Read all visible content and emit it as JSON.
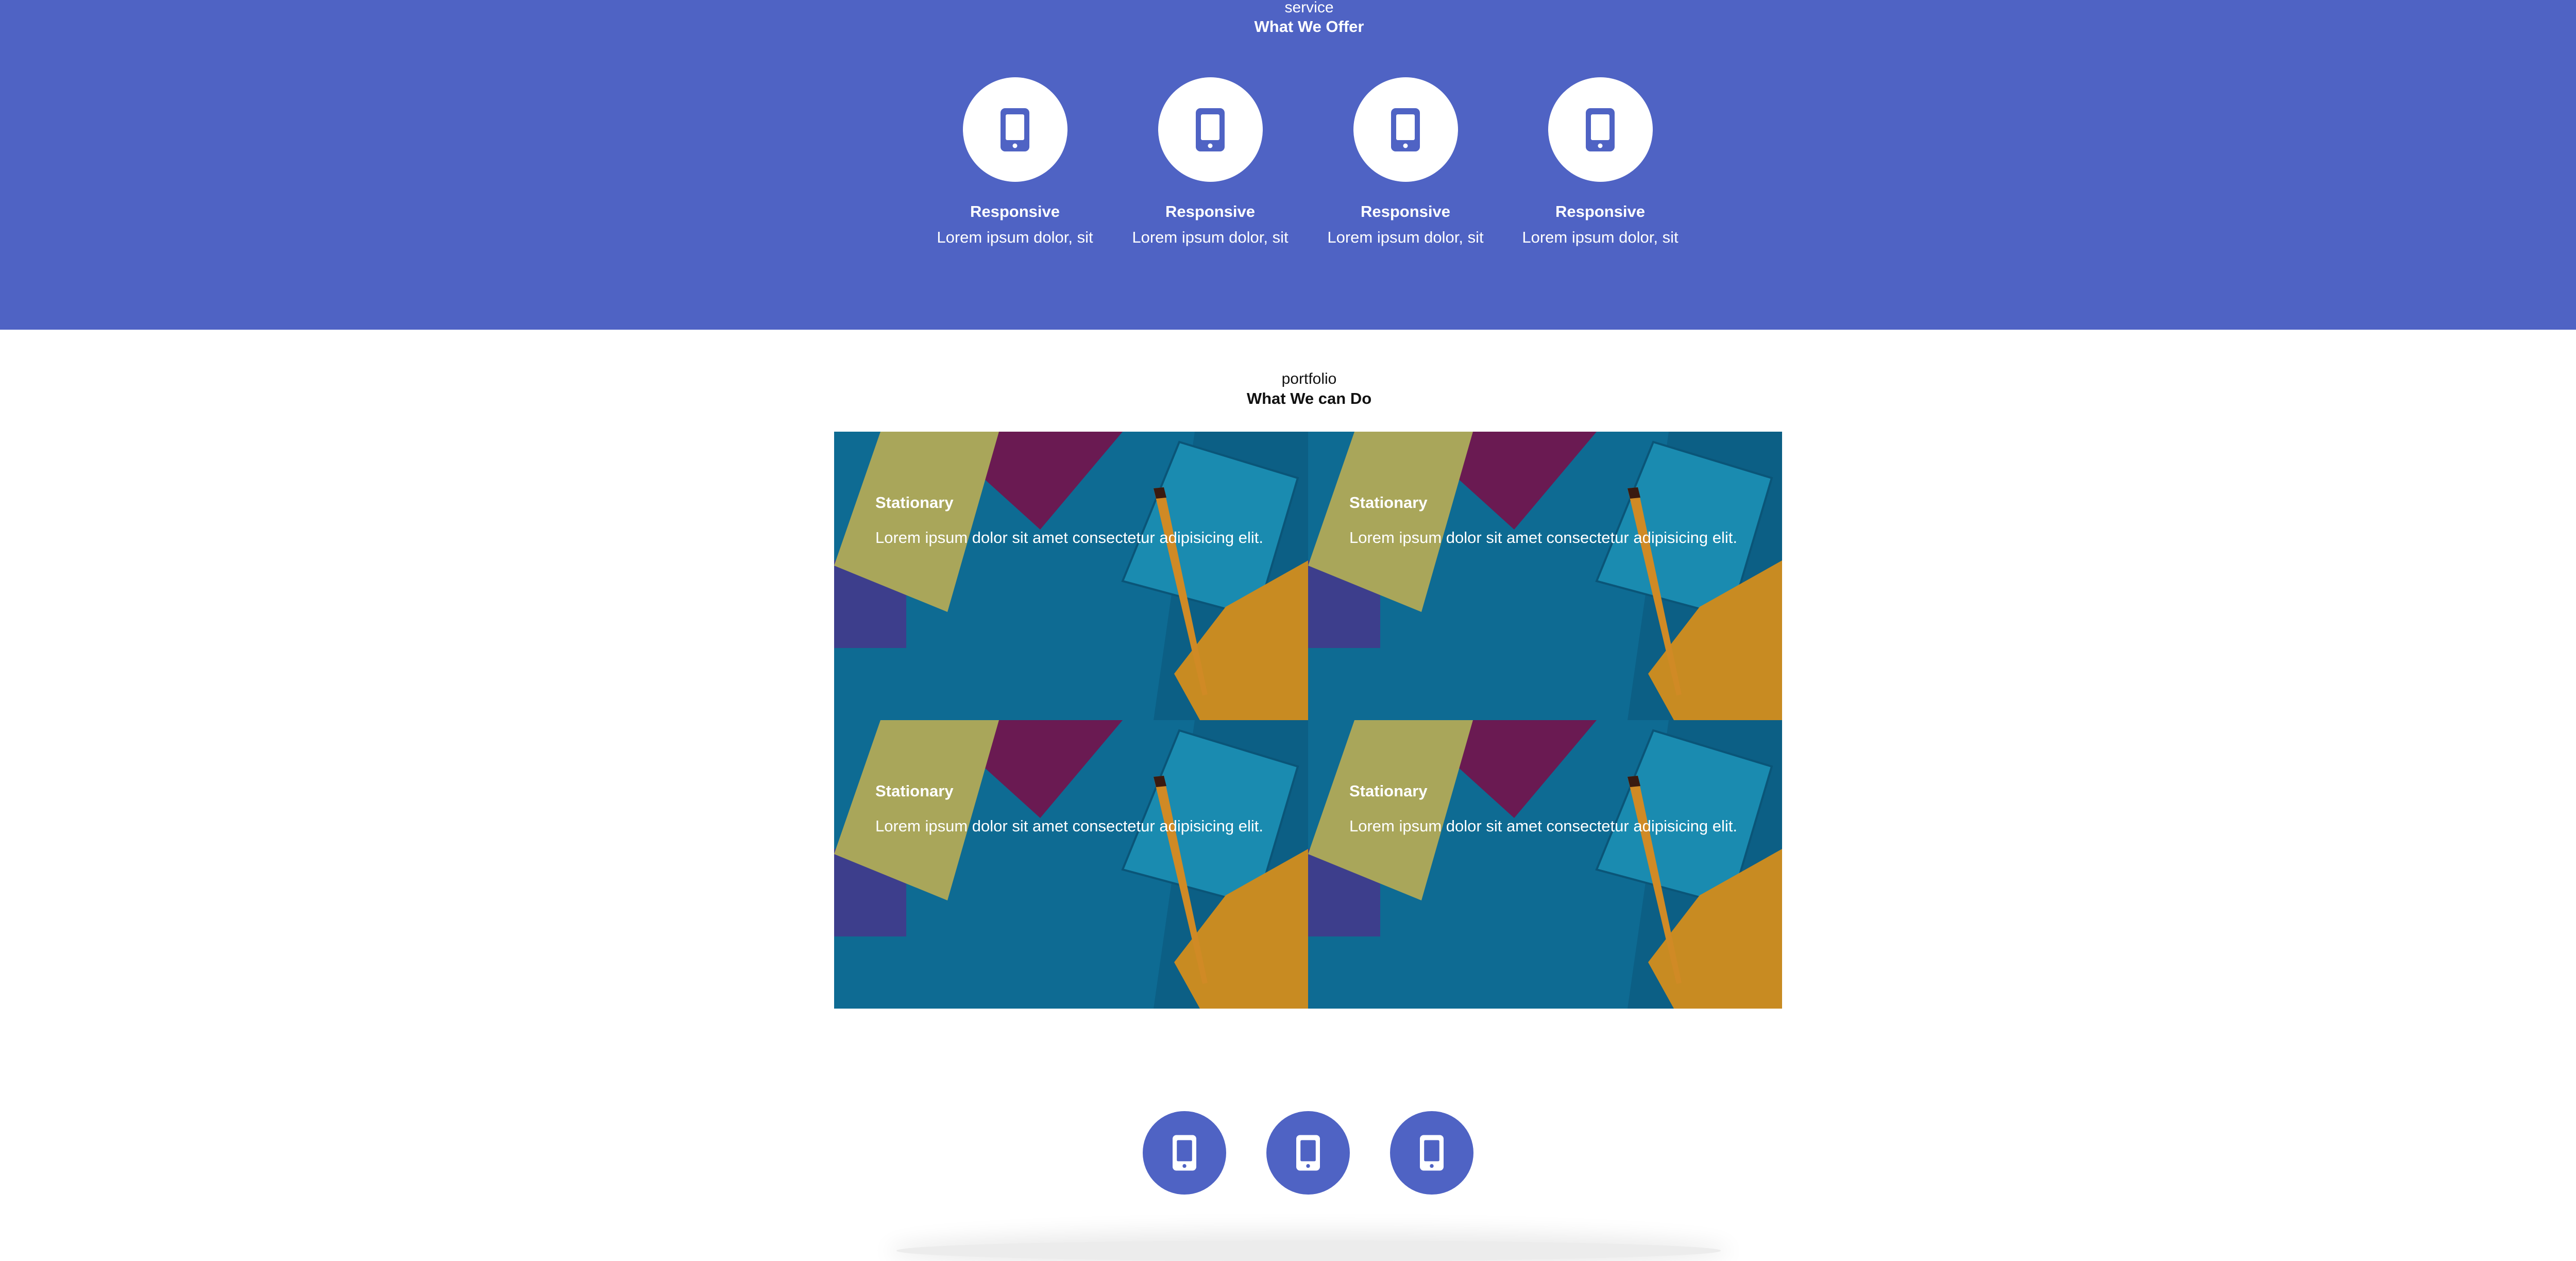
{
  "service": {
    "kicker": "service",
    "heading": "What We Offer",
    "items": [
      {
        "icon": "smartphone-icon",
        "title": "Responsive",
        "desc": "Lorem ipsum dolor, sit"
      },
      {
        "icon": "smartphone-icon",
        "title": "Responsive",
        "desc": "Lorem ipsum dolor, sit"
      },
      {
        "icon": "smartphone-icon",
        "title": "Responsive",
        "desc": "Lorem ipsum dolor, sit"
      },
      {
        "icon": "smartphone-icon",
        "title": "Responsive",
        "desc": "Lorem ipsum dolor, sit"
      }
    ]
  },
  "portfolio": {
    "kicker": "portfolio",
    "heading": "What We can Do",
    "cards": [
      {
        "title": "Stationary",
        "text": "Lorem ipsum dolor sit amet consectetur adipisicing elit."
      },
      {
        "title": "Stationary",
        "text": "Lorem ipsum dolor sit amet consectetur adipisicing elit."
      },
      {
        "title": "Stationary",
        "text": "Lorem ipsum dolor sit amet consectetur adipisicing elit."
      },
      {
        "title": "Stationary",
        "text": "Lorem ipsum dolor sit amet consectetur adipisicing elit."
      }
    ]
  },
  "bottom_icons": [
    "smartphone-icon",
    "smartphone-icon",
    "smartphone-icon"
  ],
  "colors": {
    "accent": "#4f63c4",
    "white": "#ffffff",
    "card_bg": "#0e6b93"
  }
}
